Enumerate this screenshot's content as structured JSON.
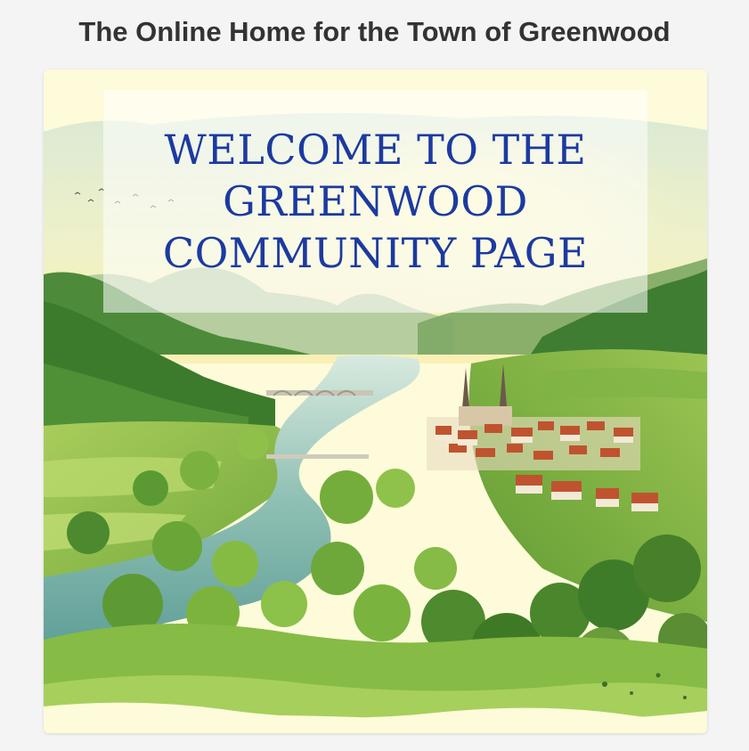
{
  "header": {
    "title": "The Online Home for the Town of Greenwood"
  },
  "hero": {
    "heading": "WELCOME TO THE GREENWOOD COMMUNITY PAGE",
    "heading_color": "#1c3aa0",
    "illustration_icon": "river-valley-town-illustration"
  },
  "colors": {
    "page_background": "#f4f4f4",
    "title_text": "#333333",
    "card_background": "#fdfbd9"
  }
}
